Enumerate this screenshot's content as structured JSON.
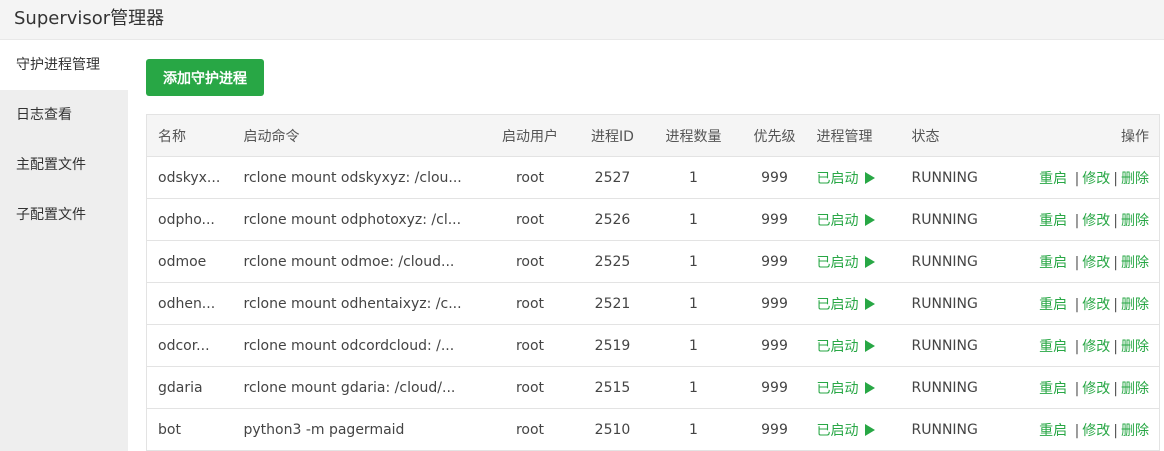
{
  "app": {
    "title": "Supervisor管理器"
  },
  "sidebar": {
    "items": [
      {
        "label": "守护进程管理"
      },
      {
        "label": "日志查看"
      },
      {
        "label": "主配置文件"
      },
      {
        "label": "子配置文件"
      }
    ]
  },
  "toolbar": {
    "add_label": "添加守护进程"
  },
  "table": {
    "headers": {
      "name": "名称",
      "command": "启动命令",
      "user": "启动用户",
      "pid": "进程ID",
      "count": "进程数量",
      "priority": "优先级",
      "manage": "进程管理",
      "status": "状态",
      "ops": "操作"
    },
    "rows": [
      {
        "name": "odskyx...",
        "command": "rclone mount odskyxyz: /clou...",
        "user": "root",
        "pid": "2527",
        "count": "1",
        "priority": "999",
        "manage": "已启动",
        "status": "RUNNING"
      },
      {
        "name": "odpho...",
        "command": "rclone mount odphotoxyz: /cl...",
        "user": "root",
        "pid": "2526",
        "count": "1",
        "priority": "999",
        "manage": "已启动",
        "status": "RUNNING"
      },
      {
        "name": "odmoe",
        "command": "rclone mount odmoe: /cloud...",
        "user": "root",
        "pid": "2525",
        "count": "1",
        "priority": "999",
        "manage": "已启动",
        "status": "RUNNING"
      },
      {
        "name": "odhen...",
        "command": "rclone mount odhentaixyz: /c...",
        "user": "root",
        "pid": "2521",
        "count": "1",
        "priority": "999",
        "manage": "已启动",
        "status": "RUNNING"
      },
      {
        "name": "odcor...",
        "command": "rclone mount odcordcloud: /...",
        "user": "root",
        "pid": "2519",
        "count": "1",
        "priority": "999",
        "manage": "已启动",
        "status": "RUNNING"
      },
      {
        "name": "gdaria",
        "command": "rclone mount gdaria: /cloud/...",
        "user": "root",
        "pid": "2515",
        "count": "1",
        "priority": "999",
        "manage": "已启动",
        "status": "RUNNING"
      },
      {
        "name": "bot",
        "command": "python3 -m pagermaid",
        "user": "root",
        "pid": "2510",
        "count": "1",
        "priority": "999",
        "manage": "已启动",
        "status": "RUNNING"
      }
    ],
    "actions": {
      "restart": "重启",
      "edit": "修改",
      "delete": "删除",
      "separator": "|"
    }
  },
  "colors": {
    "accent": "#28a745",
    "sidebar_bg": "#eeeeee",
    "header_bg": "#f5f5f5"
  },
  "icons": {
    "start_indicator": "play-icon"
  }
}
